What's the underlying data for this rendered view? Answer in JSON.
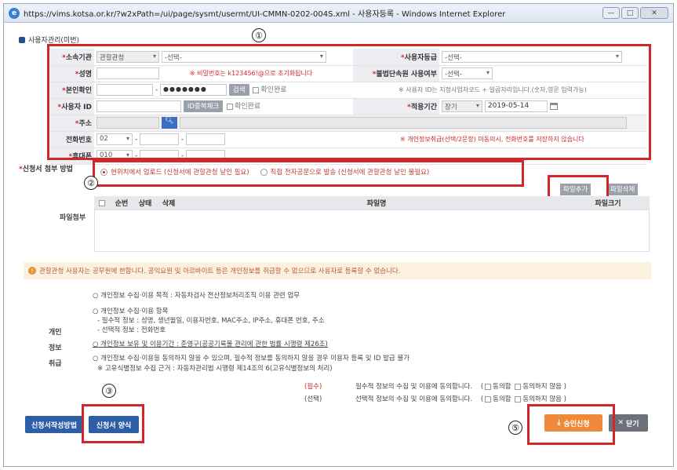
{
  "window": {
    "title": "https://vims.kotsa.or.kr/?w2xPath=/ui/page/sysmt/usermt/UI-CMMN-0202-004S.xml - 사용자등록 - Windows Internet Explorer",
    "ie_letter": "e",
    "btn_min": "—",
    "btn_max": "□",
    "btn_close": "✕"
  },
  "section_title": "사용자관리(미번)",
  "form": {
    "org_label": "소속기관",
    "org_sel1": "관할관청",
    "org_sel2": "-선택-",
    "grade_label": "사용자등급",
    "grade_sel": "-선택-",
    "name_label": "성명",
    "pw_notice": "※ 비밀번호는 k123456!@으로 초기화됩니다",
    "illegal_label": "불법단속원 사용여부",
    "illegal_sel": "-선택-",
    "id_check_label": "본인확인",
    "id_dash": "-",
    "id_masked": "●●●●●●●",
    "search_btn": "검색",
    "confirm1": "확인완료",
    "id_notice": "※ 사용자 ID는 지정사업자코드 + 일곱자리입니다.(숫자,영문 입력가능)",
    "user_id_label": "사용자 ID",
    "dup_btn": "ID중복체크",
    "confirm2": "확인완료",
    "period_label": "적용기간",
    "period_sel": "장기",
    "period_date": "2019-05-14",
    "addr_label": "주소",
    "phone_label": "전화번호",
    "phone_sel": "02",
    "phone_notice": "※ 개인정보취급(선택/2문항) 미동의시, 전화번호를 저장하지 않습니다",
    "mobile_label": "휴대폰",
    "mobile_sel": "010"
  },
  "request": {
    "label": "신청서 첨부 방법",
    "opt1": "현위치에서 업로드 (신청서에 관할관청 날인 필요)",
    "opt2": "직접 전자공문으로 발송 (신청서에 관할관청 날인 불필요)"
  },
  "files": {
    "label": "파일첨부",
    "add_btn": "파일추가",
    "del_btn": "파일삭제",
    "cols": [
      "순번",
      "상태",
      "삭제",
      "파일명",
      "파일크기"
    ]
  },
  "notice": "관할관청 사용자는 공무원에 한합니다. 공익요원 및 아르바이트 등은 개인정보를 취급할 수 없으므로 사용자로 등록할 수 없습니다.",
  "privacy": {
    "side_labels": [
      "개인",
      "정보",
      "취급"
    ],
    "line1": "○ 개인정보 수집·이용 목적 : 자동차검사 전산정보처리조직 이용 관련 업무",
    "line2": "○ 개인정보 수집·이용 항목",
    "line3": "- 필수적 정보 : 성명, 생년월일, 이용자번호, MAC주소, IP주소, 휴대폰 번호, 주소",
    "line4": "- 선택적 정보 : 전화번호",
    "line5": "○ 개인정보 보유 및 이용기간 : 준영구(공공기록물 관리에 관한 법률 시행령 제26조)",
    "line6": "○ 개인정보 수집·이용을 동의하지 않을 수 있으며, 필수적 정보를 동의하지 않을 경우 이용자 등록 및 ID 발급 불가",
    "line7": "※ 고유식별정보 수집 근거 : 자동차관리법 시행령 제14조의 6(고유식별정보의 처리)",
    "req_tag": "(필수)",
    "req_text": "필수적 정보의 수집 및 이용에 동의합니다.",
    "opt_tag": "(선택)",
    "opt_text": "선택적 정보의 수집 및 이용에 동의합니다.",
    "agree": "동의함",
    "disagree": "동의하지 않음"
  },
  "buttons": {
    "guide": "신청서작성방법",
    "form": "신청서 양식",
    "approve": "승인신청",
    "close": "닫기"
  },
  "markers": [
    "①",
    "②",
    "③",
    "④",
    "⑤"
  ]
}
